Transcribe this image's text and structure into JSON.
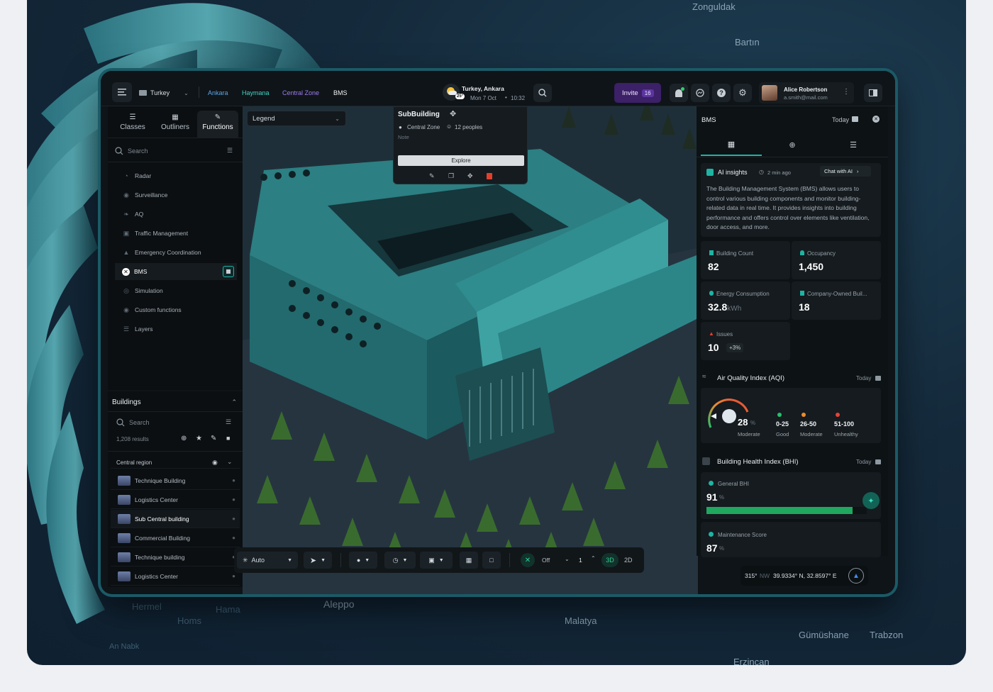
{
  "map_labels": [
    "Zonguldak",
    "Bartın",
    "Hermel",
    "Hama",
    "Aleppo",
    "Homs",
    "An Nabk",
    "Malatya",
    "Gümüshane",
    "Trabzon",
    "Erzincan"
  ],
  "header": {
    "country": "Turkey",
    "breadcrumbs": [
      "Ankara",
      "Haymana",
      "Central Zone",
      "BMS"
    ],
    "location": "Turkey, Ankara",
    "temp": "25°",
    "date": "Mon 7 Oct",
    "time": "10:32",
    "invite_label": "Invite",
    "invite_count": "16",
    "user_name": "Alice Robertson",
    "user_email": "a.smith@mail.com"
  },
  "sidebar": {
    "tabs": [
      "Classes",
      "Outliners",
      "Functions"
    ],
    "search_placeholder": "Search",
    "items": [
      {
        "label": "Radar",
        "icon": "radar-icon"
      },
      {
        "label": "Surveillance",
        "icon": "camera-icon"
      },
      {
        "label": "AQ",
        "icon": "leaf-icon"
      },
      {
        "label": "Traffic Management",
        "icon": "car-icon"
      },
      {
        "label": "Emergency Coordination",
        "icon": "siren-icon"
      },
      {
        "label": "BMS",
        "icon": "close-icon"
      },
      {
        "label": "Simulation",
        "icon": "simulation-icon"
      },
      {
        "label": "Custom functions",
        "icon": "function-icon"
      },
      {
        "label": "Layers",
        "icon": "layers-icon"
      }
    ]
  },
  "buildings": {
    "title": "Buildings",
    "search_placeholder": "Search",
    "results": "1,208 results",
    "group": "Central region",
    "rows": [
      "Technique Building",
      "Logistics Center",
      "Sub Central building",
      "Commercial Building",
      "Technique building",
      "Logistics Center"
    ]
  },
  "legend": {
    "label": "Legend"
  },
  "popup": {
    "title": "SubBuilding",
    "zone": "Central Zone",
    "people": "12 peoples",
    "note": "Note",
    "explore": "Explore"
  },
  "toolbar": {
    "mode": "Auto",
    "off": "Off",
    "level": "1",
    "view3d": "3D",
    "view2d": "2D"
  },
  "coords": {
    "heading": "315°",
    "dir": "NW",
    "latlon": "39.9334° N, 32.8597° E"
  },
  "right_panel": {
    "title": "BMS",
    "period": "Today",
    "ai": {
      "title": "AI insights",
      "ago": "2 min ago",
      "chat": "Chat with AI",
      "text": "The Building Management System (BMS) allows users to control various building components and monitor building-related data in real time. It provides insights into building performance and offers control over elements like ventilation, door access, and more."
    },
    "stats": [
      {
        "label": "Building Count",
        "value": "82",
        "unit": ""
      },
      {
        "label": "Occupancy",
        "value": "1,450",
        "unit": ""
      },
      {
        "label": "Energy Consumption",
        "value": "32.8",
        "unit": "kWh"
      },
      {
        "label": "Company-Owned Buil...",
        "value": "18",
        "unit": ""
      },
      {
        "label": "Issues",
        "value": "10",
        "unit": "+3%"
      }
    ],
    "aqi": {
      "title": "Air Quality Index (AQI)",
      "period": "Today",
      "value": "28",
      "unit": "%",
      "status": "Moderate",
      "ranges": [
        {
          "range": "0-25",
          "label": "Good",
          "color": "#27c06b"
        },
        {
          "range": "26-50",
          "label": "Moderate",
          "color": "#f08a2c"
        },
        {
          "range": "51-100",
          "label": "Unhealthy",
          "color": "#e5423a"
        }
      ]
    },
    "bhi": {
      "title": "Building Health Index (BHI)",
      "period": "Today",
      "general_label": "General BHI",
      "general_value": "91",
      "general_fraction": 0.91,
      "maint_label": "Maintenance Score",
      "maint_value": "87",
      "unit": "%"
    }
  },
  "colors": {
    "accent": "#1fb3a3",
    "bar": "#1fa85e",
    "invite_bg": "#3c2068"
  }
}
